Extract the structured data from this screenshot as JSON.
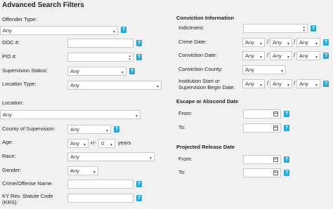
{
  "title": "Advanced Search Filters",
  "left": {
    "offender_type": {
      "label": "Offender Type:",
      "value": "Any"
    },
    "doc": {
      "label": "DOC #:"
    },
    "pid": {
      "label": "PID #:"
    },
    "supervision_status": {
      "label": "Supervision Status:",
      "value": "Any"
    },
    "location_type": {
      "label": "Location Type:",
      "value": "Any"
    },
    "location": {
      "label": "Location:",
      "value": "Any"
    },
    "county_of_supervision": {
      "label": "County of Supervision:",
      "value": "Any"
    },
    "age": {
      "label": "Age:",
      "value": "Any",
      "pm": "+/-",
      "range": "0",
      "unit": "years"
    },
    "race": {
      "label": "Race:",
      "value": "Any"
    },
    "gender": {
      "label": "Gender:",
      "value": "Any"
    },
    "crime": {
      "label": "Crime/Offense Name:"
    },
    "krs": {
      "label1": "KY Rev. Statute Code",
      "label2": "(KRS):"
    }
  },
  "conviction": {
    "heading": "Conviction Information",
    "indictment": {
      "label": "Indictment:"
    },
    "crime_date": {
      "label": "Crime Date:",
      "m": "Any",
      "d": "Any",
      "y": "Any"
    },
    "conviction_date": {
      "label": "Conviction Date:",
      "m": "Any",
      "d": "Any",
      "y": "Any"
    },
    "conviction_county": {
      "label": "Conviction County:",
      "value": "Any"
    },
    "inst_start": {
      "label1": "Institution Start or",
      "label2": "Supervision Begin Date:",
      "m": "Any",
      "d": "Any",
      "y": "Any"
    },
    "slash": "/"
  },
  "escape": {
    "heading": "Escape or Abscond Date",
    "from": "From:",
    "to": "To:"
  },
  "release": {
    "heading": "Projected Release Date",
    "from": "From:",
    "to": "To:"
  },
  "help": "?"
}
